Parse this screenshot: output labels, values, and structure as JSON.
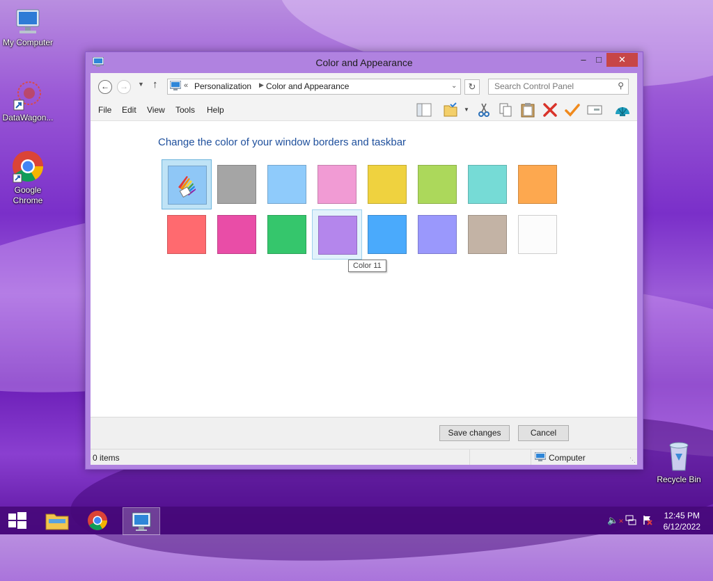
{
  "desktop": {
    "icons": [
      {
        "label": "My Computer"
      },
      {
        "label": "DataWagon..."
      },
      {
        "label": "Google\nChrome"
      },
      {
        "label": "Recycle Bin"
      }
    ]
  },
  "window": {
    "title": "Color and Appearance",
    "controls": {
      "minimize": "–",
      "maximize": "□",
      "close": "✕"
    },
    "address": {
      "prefix": "«",
      "crumbs": [
        "Personalization",
        "Color and Appearance"
      ]
    },
    "search": {
      "placeholder": "Search Control Panel"
    },
    "menu": [
      "File",
      "Edit",
      "View",
      "Tools",
      "Help"
    ],
    "heading": "Change the color of your window borders and taskbar",
    "swatches_row1": [
      "#8fc7f6",
      "#a5a5a5",
      "#8fcbfb",
      "#f19bd4",
      "#efd23f",
      "#acd85b",
      "#76dbd6",
      "#fda84f"
    ],
    "swatches_row2": [
      "#ff6a6f",
      "#e94da7",
      "#35c66c",
      "#b486ec",
      "#4aaafc",
      "#9a98fc",
      "#c3b3a5",
      "#fcfcfc"
    ],
    "tooltip": "Color 11",
    "buttons": {
      "save": "Save changes",
      "cancel": "Cancel"
    },
    "status": {
      "items": "0 items",
      "location": "Computer"
    }
  },
  "taskbar": {
    "time": "12:45 PM",
    "date": "6/12/2022"
  }
}
